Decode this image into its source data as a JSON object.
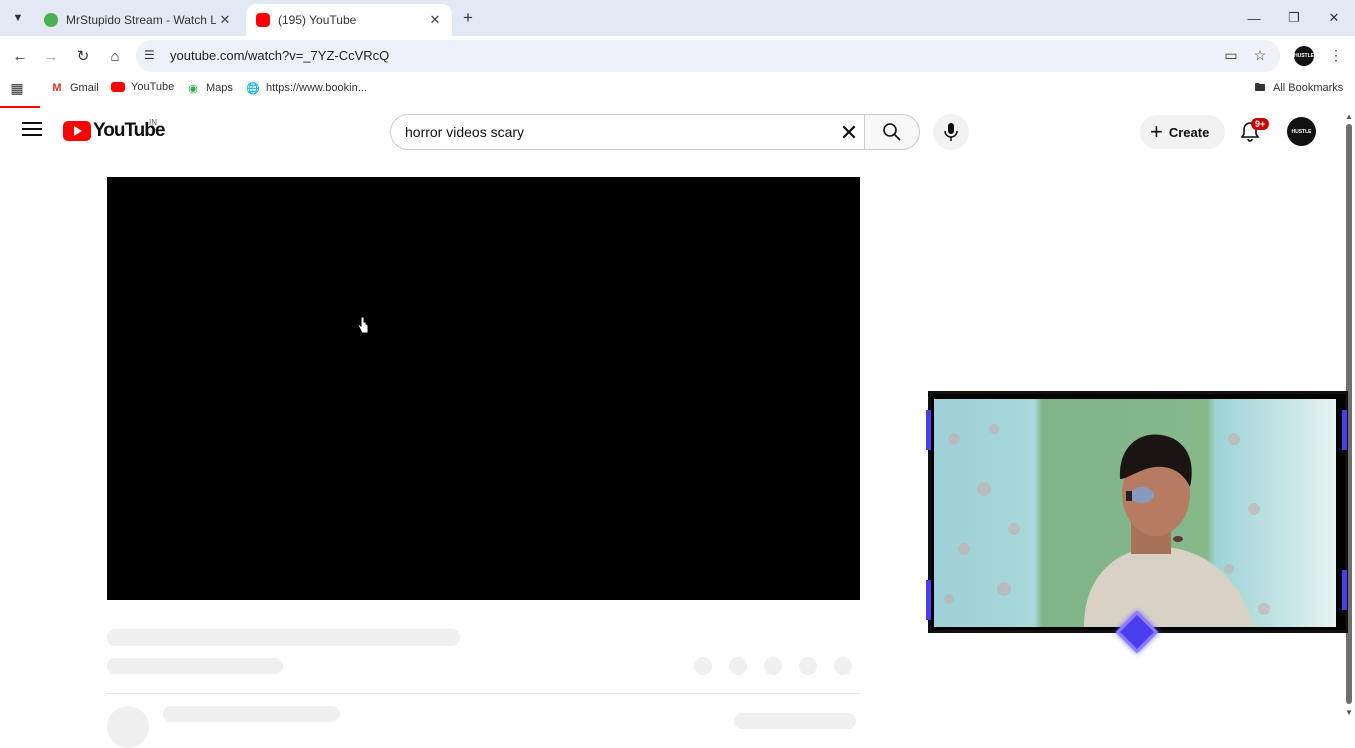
{
  "browser": {
    "tabs": [
      {
        "title": "MrStupido Stream - Watch Live",
        "active": false,
        "favicon_color": "#4caf50"
      },
      {
        "title": "(195) YouTube",
        "active": true,
        "favicon_color": "#ff0000"
      }
    ],
    "url": "youtube.com/watch?v=_7YZ-CcVRcQ",
    "profile_label": "HUSTLE",
    "bookmarks": [
      {
        "label": "Gmail",
        "icon": "gmail-icon"
      },
      {
        "label": "YouTube",
        "icon": "youtube-icon"
      },
      {
        "label": "Maps",
        "icon": "maps-icon"
      },
      {
        "label": "https://www.bookin...",
        "icon": "globe-icon"
      }
    ],
    "all_bookmarks": "All Bookmarks"
  },
  "youtube": {
    "logo_text": "YouTube",
    "country_code": "IN",
    "search_query": "horror videos scary",
    "create_label": "Create",
    "notification_count": "9+",
    "avatar_label": "HUSTLE"
  },
  "colors": {
    "tabbar_bg": "#e3e9f4",
    "youtube_red": "#ff0000",
    "overlay_accent": "#4c3cf0"
  }
}
